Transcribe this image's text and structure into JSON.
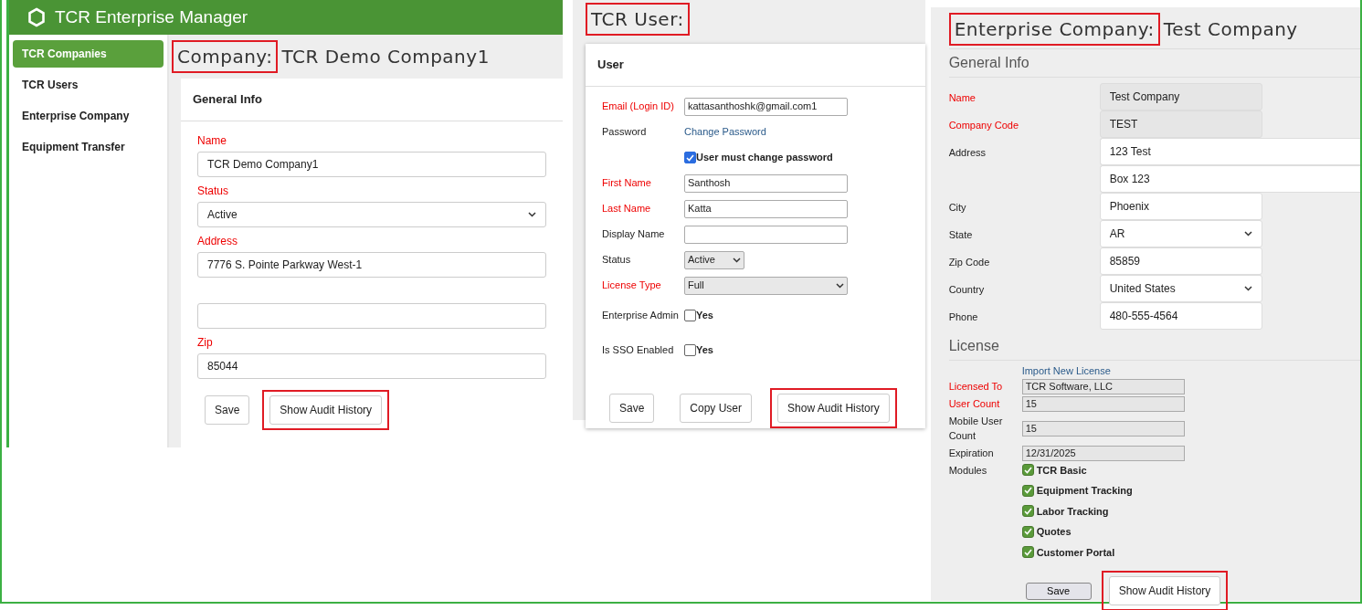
{
  "company_screen": {
    "app_title": "TCR Enterprise Manager",
    "sidebar": [
      {
        "label": "TCR Companies",
        "selected": true
      },
      {
        "label": "TCR Users",
        "selected": false
      },
      {
        "label": "Enterprise Company",
        "selected": false
      },
      {
        "label": "Equipment Transfer",
        "selected": false
      }
    ],
    "page_title": {
      "label": "Company:",
      "value": "TCR Demo Company1",
      "highlighted": true
    },
    "section": "General Info",
    "fields": [
      {
        "kind": "input",
        "label": "Name",
        "required": true,
        "value": "TCR Demo Company1"
      },
      {
        "kind": "select",
        "label": "Status",
        "required": true,
        "value": "Active"
      },
      {
        "kind": "input",
        "label": "Address",
        "required": true,
        "value": "7776 S. Pointe Parkway West-1"
      },
      {
        "kind": "input"
      },
      {
        "kind": "input",
        "label": "Zip",
        "required": true,
        "value": "85044"
      }
    ],
    "buttons": [
      {
        "label": "Save",
        "highlighted": false
      },
      {
        "label": "Show Audit History",
        "highlighted": true
      }
    ]
  },
  "user_screen": {
    "page_title": {
      "label": "TCR User:",
      "highlighted": true
    },
    "section": "User",
    "fields": [
      {
        "kind": "input",
        "label": "Email (Login ID)",
        "required": true,
        "value": "kattasanthoshk@gmail.com1"
      },
      {
        "kind": "link",
        "label": "Password",
        "value": "Change Password"
      },
      {
        "kind": "checkbox",
        "text": "User must change password",
        "checked": true
      },
      {
        "kind": "input",
        "label": "First Name",
        "required": true,
        "value": "Santhosh"
      },
      {
        "kind": "input",
        "label": "Last Name",
        "required": true,
        "value": "Katta"
      },
      {
        "kind": "input",
        "label": "Display Name",
        "required": false
      },
      {
        "kind": "select-short",
        "label": "Status",
        "required": false,
        "value": "Active"
      },
      {
        "kind": "select",
        "label": "License Type",
        "required": true,
        "value": "Full"
      },
      {
        "kind": "checkbox",
        "label": "Enterprise Admin",
        "text": "Yes",
        "checked": false
      },
      {
        "kind": "checkbox",
        "label": "Is SSO Enabled",
        "text": "Yes",
        "checked": false
      }
    ],
    "buttons": [
      {
        "label": "Save",
        "highlighted": false
      },
      {
        "label": "Copy User",
        "highlighted": false
      },
      {
        "label": "Show Audit History",
        "highlighted": true
      }
    ]
  },
  "enterprise_screen": {
    "page_title": {
      "label": "Enterprise Company:",
      "value": "Test Company",
      "highlighted": true
    },
    "general_heading": "General Info",
    "fields": [
      {
        "kind": "input",
        "label": "Name",
        "required": true,
        "readonly": true,
        "value": "Test Company"
      },
      {
        "kind": "input",
        "label": "Company Code",
        "required": true,
        "readonly": true,
        "value": "TEST"
      },
      {
        "kind": "address-line",
        "label": "Address",
        "required": false,
        "value": "123 Test"
      },
      {
        "kind": "address-line",
        "value": "Box 123"
      },
      {
        "kind": "input",
        "label": "City",
        "required": false,
        "readonly": false,
        "value": "Phoenix"
      },
      {
        "kind": "select",
        "label": "State",
        "required": false,
        "value": "AR"
      },
      {
        "kind": "input",
        "label": "Zip Code",
        "required": false,
        "readonly": false,
        "value": "85859"
      },
      {
        "kind": "select",
        "label": "Country",
        "required": false,
        "value": "United States"
      },
      {
        "kind": "input",
        "label": "Phone",
        "required": false,
        "readonly": false,
        "value": "480-555-4564"
      }
    ],
    "license_heading": "License",
    "import_link": "Import New License",
    "license_fields": [
      {
        "label": "Licensed To",
        "required": true,
        "value": "TCR Software, LLC"
      },
      {
        "label": "User Count",
        "required": true,
        "value": "15"
      },
      {
        "label": "Mobile User Count",
        "required": false,
        "value": "15"
      },
      {
        "label": "Expiration",
        "required": false,
        "value": "12/31/2025"
      }
    ],
    "modules_label": "Modules",
    "modules": [
      {
        "label": "TCR Basic",
        "checked": true
      },
      {
        "label": "Equipment Tracking",
        "checked": true
      },
      {
        "label": "Labor Tracking",
        "checked": true
      },
      {
        "label": "Quotes",
        "checked": true
      },
      {
        "label": "Customer Portal",
        "checked": true
      }
    ],
    "buttons": [
      {
        "label": "Save",
        "highlighted": false
      },
      {
        "label": "Show Audit History",
        "highlighted": true
      }
    ]
  }
}
